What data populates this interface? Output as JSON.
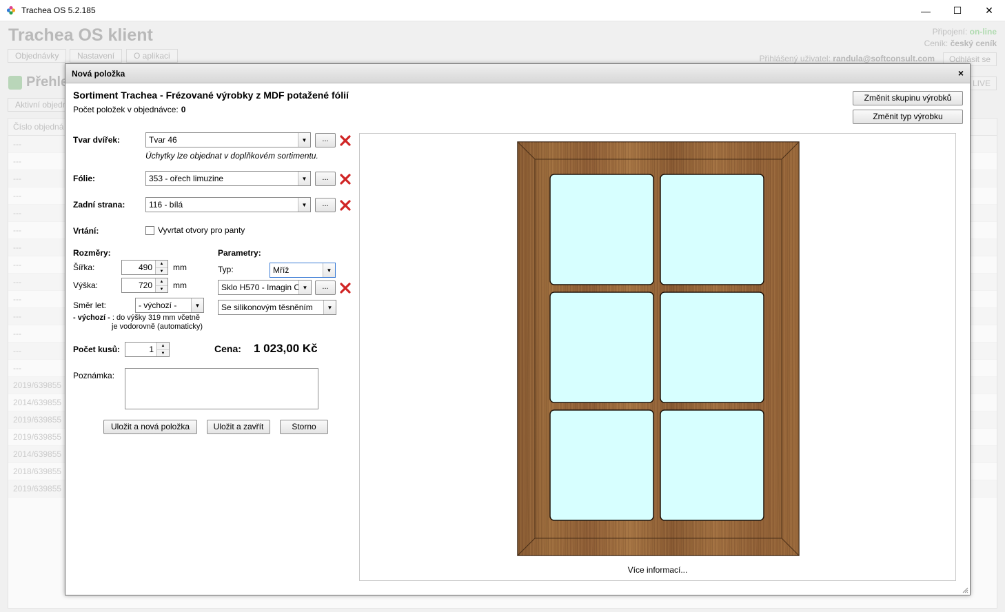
{
  "os_window": {
    "title": "Trachea OS 5.2.185",
    "minimize_glyph": "—",
    "maximize_glyph": "☐",
    "close_glyph": "✕"
  },
  "background_app": {
    "title": "Trachea OS klient",
    "tabs": [
      "Objednávky",
      "Nastavení",
      "O aplikaci"
    ],
    "connection_label": "Připojení:",
    "connection_value": "on-line",
    "pricelist_label": "Ceník:",
    "pricelist_value": "český ceník",
    "user_label": "Přihlášený uživatel:",
    "user_value": "randula@softconsult.com",
    "logout_button": "Odhlásit se",
    "overview_title": "Přehle",
    "active_orders_button": "Aktivní objedn",
    "live_button": "LIVE",
    "column_header": "Číslo objedná",
    "rows": [
      "---",
      "---",
      "---",
      "---",
      "---",
      "---",
      "---",
      "---",
      "---",
      "---",
      "---",
      "---",
      "---",
      "---",
      "2019/639855",
      "2014/639855",
      "2019/639855",
      "2019/639855",
      "2014/639855",
      "2018/639855",
      "2019/639855"
    ]
  },
  "dialog": {
    "title": "Nová položka",
    "close_glyph": "×",
    "heading": "Sortiment Trachea - Frézované výrobky z MDF potažené fólií",
    "count_label": "Počet položek v objednávce:",
    "count_value": "0",
    "change_group_button": "Změnit skupinu výrobků",
    "change_type_button": "Změnit typ výrobku",
    "door_shape_label": "Tvar dvířek:",
    "door_shape_value": "Tvar 46",
    "handles_hint": "Úchytky lze objednat v doplňkovém sortimentu.",
    "foil_label": "Fólie:",
    "foil_value": "353 - ořech limuzine",
    "back_label": "Zadní strana:",
    "back_value": "116 - bílá",
    "drilling_label": "Vrtání:",
    "drilling_checkbox_label": "Vyvrtat otvory pro panty",
    "dots_label": "...",
    "dimensions_label": "Rozměry:",
    "width_label": "Šířka:",
    "width_value": "490",
    "height_label": "Výška:",
    "height_value": "720",
    "unit_mm": "mm",
    "grain_label": "Směr let:",
    "grain_value": "- výchozí -",
    "grain_note_bold": "- výchozí -",
    "grain_note_1": ": do výšky 319 mm včetně",
    "grain_note_2": "je vodorovně (automaticky)",
    "params_label": "Parametry:",
    "type_label": "Typ:",
    "type_value": "Mříž",
    "glass_value": "Sklo H570 - Imagin C",
    "seal_value": "Se silikonovým těsněním",
    "pieces_label": "Počet kusů:",
    "pieces_value": "1",
    "price_label": "Cena:",
    "price_value": "1 023,00 Kč",
    "note_label": "Poznámka:",
    "save_new_button": "Uložit a nová položka",
    "save_close_button": "Uložit a zavřít",
    "cancel_button": "Storno",
    "more_info_link": "Více informací...",
    "preview_grid": {
      "columns": 2,
      "rows": 3
    },
    "colors": {
      "wood": "#8b5e34",
      "glass": "#d7ffff",
      "delete_icon": "#d02424"
    }
  }
}
